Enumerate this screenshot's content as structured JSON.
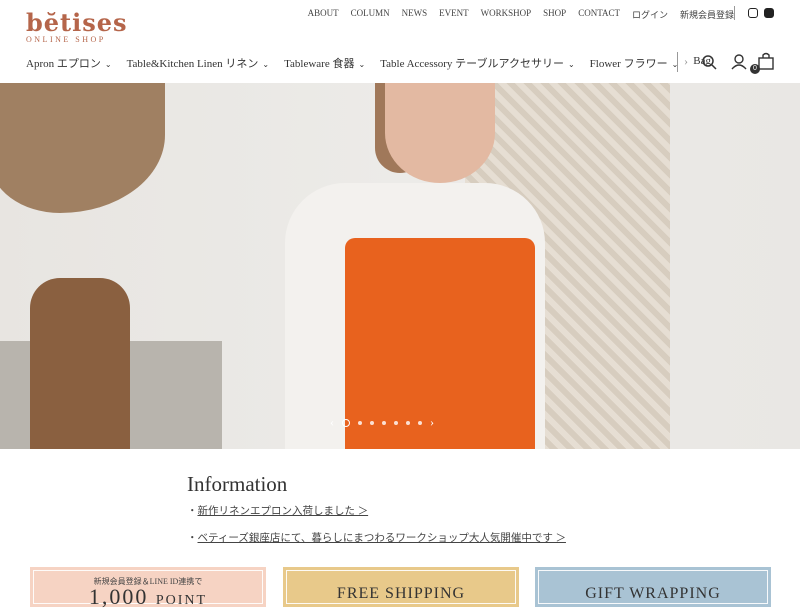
{
  "header": {
    "logo": "bĕtises",
    "logo_sub": "ONLINE SHOP",
    "top_links": [
      "ABOUT",
      "COLUMN",
      "NEWS",
      "EVENT",
      "WORKSHOP",
      "SHOP",
      "CONTACT",
      "ログイン",
      "新規会員登録"
    ],
    "cart_count": "0"
  },
  "nav": {
    "items": [
      {
        "label": "Apron エプロン"
      },
      {
        "label": "Table&Kitchen Linen リネン"
      },
      {
        "label": "Tableware 食器"
      },
      {
        "label": "Table Accessory テーブルアクセサリー"
      },
      {
        "label": "Flower フラワー"
      },
      {
        "label": "Bag"
      }
    ]
  },
  "carousel": {
    "slides": 7,
    "active": 1
  },
  "info": {
    "title": "Information",
    "items": [
      "新作リネンエプロン入荷しました ＞",
      "ベティーズ銀座店にて、暮らしにまつわるワークショップ大人気開催中です ＞"
    ]
  },
  "banners": {
    "b1_small": "新規会員登録＆LINE ID連携で",
    "b1_big": "1,000",
    "b1_unit": "POINT",
    "b2": "FREE SHIPPING",
    "b3": "GIFT WRAPPING"
  },
  "colors": {
    "brand": "#b5654a",
    "banner1": "#f6d3c3",
    "banner2": "#e8c98a",
    "banner3": "#a9c3d4"
  }
}
